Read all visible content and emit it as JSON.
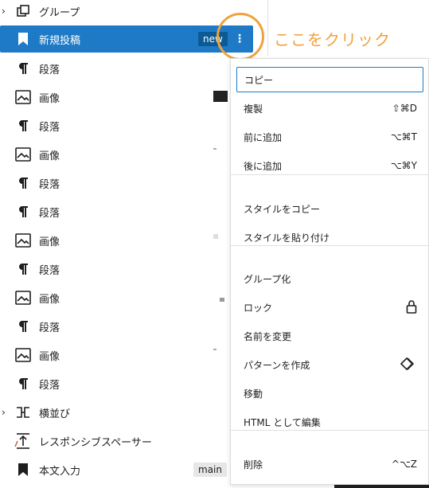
{
  "list": {
    "items": [
      {
        "label": "グループ",
        "icon": "group-icon",
        "chevron": "›"
      },
      {
        "label": "新規投稿",
        "icon": "bookmark-icon",
        "badge": "new",
        "selected": true
      },
      {
        "label": "段落",
        "icon": "paragraph-icon"
      },
      {
        "label": "画像",
        "icon": "image-icon"
      },
      {
        "label": "段落",
        "icon": "paragraph-icon"
      },
      {
        "label": "画像",
        "icon": "image-icon"
      },
      {
        "label": "段落",
        "icon": "paragraph-icon"
      },
      {
        "label": "段落",
        "icon": "paragraph-icon"
      },
      {
        "label": "画像",
        "icon": "image-icon"
      },
      {
        "label": "段落",
        "icon": "paragraph-icon"
      },
      {
        "label": "画像",
        "icon": "image-icon"
      },
      {
        "label": "段落",
        "icon": "paragraph-icon"
      },
      {
        "label": "画像",
        "icon": "image-icon"
      },
      {
        "label": "段落",
        "icon": "paragraph-icon"
      },
      {
        "label": "横並び",
        "icon": "columns-icon",
        "chevron": "›"
      },
      {
        "label": "レスポンシブスペーサー",
        "icon": "spacer-icon"
      },
      {
        "label": "本文入力",
        "icon": "bookmark-icon",
        "badge": "main"
      }
    ]
  },
  "callout": {
    "text": "ここをクリック",
    "color": "#f0a23c"
  },
  "menu": {
    "groups": [
      [
        {
          "label": "コピー",
          "shortcut": ""
        },
        {
          "label": "複製",
          "shortcut": "⇧⌘D"
        },
        {
          "label": "前に追加",
          "shortcut": "⌥⌘T"
        },
        {
          "label": "後に追加",
          "shortcut": "⌥⌘Y"
        }
      ],
      [
        {
          "label": "スタイルをコピー",
          "shortcut": ""
        },
        {
          "label": "スタイルを貼り付け",
          "shortcut": ""
        }
      ],
      [
        {
          "label": "グループ化",
          "shortcut": ""
        },
        {
          "label": "ロック",
          "shortcut": "",
          "icon": "lock-icon"
        },
        {
          "label": "名前を変更",
          "shortcut": ""
        },
        {
          "label": "パターンを作成",
          "shortcut": "",
          "icon": "pattern-icon"
        },
        {
          "label": "移動",
          "shortcut": ""
        },
        {
          "label": "HTML として編集",
          "shortcut": ""
        }
      ],
      [
        {
          "label": "削除",
          "shortcut": "^⌥Z"
        }
      ]
    ]
  },
  "colors": {
    "accent": "#1e7ac6",
    "callout": "#f0a23c"
  }
}
